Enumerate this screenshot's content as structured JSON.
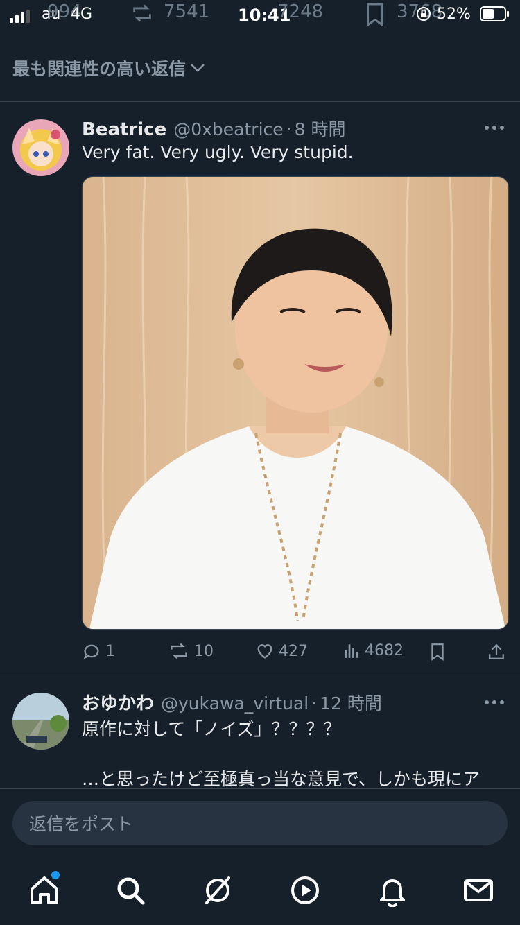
{
  "status_bar": {
    "carrier": "au",
    "network": "4G",
    "time": "10:41",
    "battery": "52%",
    "ghost_replies": "994",
    "ghost_retweets": "7541",
    "ghost_likes": "7248",
    "ghost_bookmarks": "3768"
  },
  "sort": {
    "label": "最も関連性の高い返信"
  },
  "tweets": [
    {
      "name": "Beatrice",
      "handle": "@0xbeatrice",
      "sep": "·",
      "time": "8 時間",
      "text": "Very fat. Very ugly. Very stupid.",
      "replies": "1",
      "retweets": "10",
      "likes": "427",
      "views": "4682"
    },
    {
      "name": "おゆかわ",
      "handle": "@yukawa_virtual",
      "sep": "·",
      "time": "12 時間",
      "text_line1": "原作に対して「ノイズ」？？？？",
      "text_line2": "…と思ったけど至極真っ当な意見で、しかも現にア"
    }
  ],
  "reply": {
    "placeholder": "返信をポスト"
  },
  "colors": {
    "background": "#15202b",
    "accent": "#1d9bf0",
    "muted": "#8b98a5"
  },
  "tabs": [
    "home-icon",
    "search-icon",
    "grok-icon",
    "video-icon",
    "bell-icon",
    "mail-icon"
  ]
}
